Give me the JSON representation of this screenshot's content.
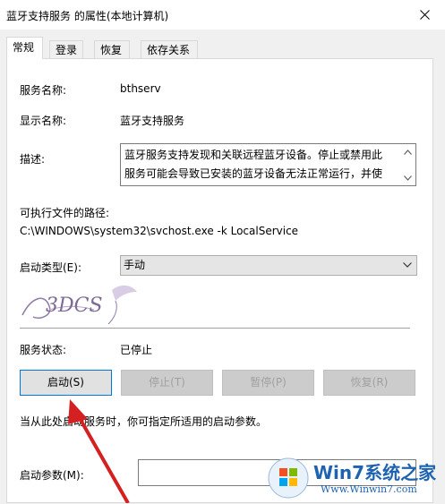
{
  "window": {
    "title": "蓝牙支持服务 的属性(本地计算机)"
  },
  "tabs": [
    {
      "label": "常规",
      "active": true
    },
    {
      "label": "登录",
      "active": false
    },
    {
      "label": "恢复",
      "active": false
    },
    {
      "label": "依存关系",
      "active": false
    }
  ],
  "general": {
    "service_name_label": "服务名称:",
    "service_name": "bthserv",
    "display_name_label": "显示名称:",
    "display_name": "蓝牙支持服务",
    "description_label": "描述:",
    "description_line1": "蓝牙服务支持发现和关联远程蓝牙设备。停止或禁用此",
    "description_line2": "服务可能会导致已安装的蓝牙设备无法正常运行，并使",
    "path_label": "可执行文件的路径:",
    "path": "C:\\WINDOWS\\system32\\svchost.exe -k LocalService",
    "startup_type_label": "启动类型(E):",
    "startup_type": "手动",
    "status_label": "服务状态:",
    "status": "已停止",
    "buttons": {
      "start": "启动(S)",
      "stop": "停止(T)",
      "pause": "暂停(P)",
      "resume": "恢复(R)"
    },
    "hint": "当从此处启动服务时，你可指定所适用的启动参数。",
    "params_label": "启动参数(M):",
    "params_value": ""
  },
  "watermark": {
    "text": "3DCS"
  },
  "brand": {
    "name": "Win7系统之家",
    "url": "Www.Winwin7.com"
  },
  "colors": {
    "accent": "#0078d7",
    "annotation_arrow": "#d42020"
  }
}
